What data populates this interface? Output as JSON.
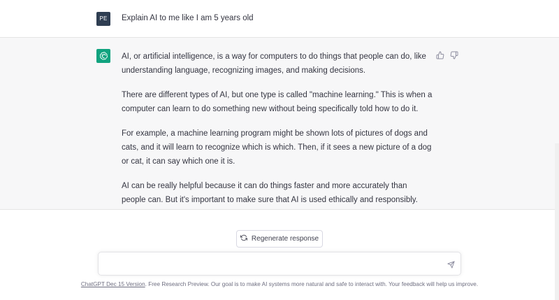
{
  "user_message": {
    "avatar_initials": "PE",
    "text": "Explain AI to me like I am 5 years old"
  },
  "assistant_message": {
    "avatar_icon": "openai-logo-icon",
    "paragraphs": [
      "AI, or artificial intelligence, is a way for computers to do things that people can do, like understanding language, recognizing images, and making decisions.",
      "There are different types of AI, but one type is called \"machine learning.\" This is when a computer can learn to do something new without being specifically told how to do it.",
      "For example, a machine learning program might be shown lots of pictures of dogs and cats, and it will learn to recognize which is which. Then, if it sees a new picture of a dog or cat, it can say which one it is.",
      "AI can be really helpful because it can do things faster and more accurately than people can. But it's important to make sure that AI is used ethically and responsibly."
    ],
    "feedback_icons": [
      "thumbs-up-icon",
      "thumbs-down-icon"
    ]
  },
  "composer": {
    "regenerate_label": "Regenerate response",
    "regenerate_icon": "refresh-icon",
    "input_value": "",
    "send_icon": "paper-plane-icon"
  },
  "footer": {
    "version_link": "ChatGPT Dec 15 Version",
    "text": ". Free Research Preview. Our goal is to make AI systems more natural and safe to interact with. Your feedback will help us improve."
  },
  "colors": {
    "user_avatar": "#2f3e52",
    "assistant_avatar": "#10a37f",
    "assistant_bg": "#f7f7f8",
    "text": "#343541"
  }
}
